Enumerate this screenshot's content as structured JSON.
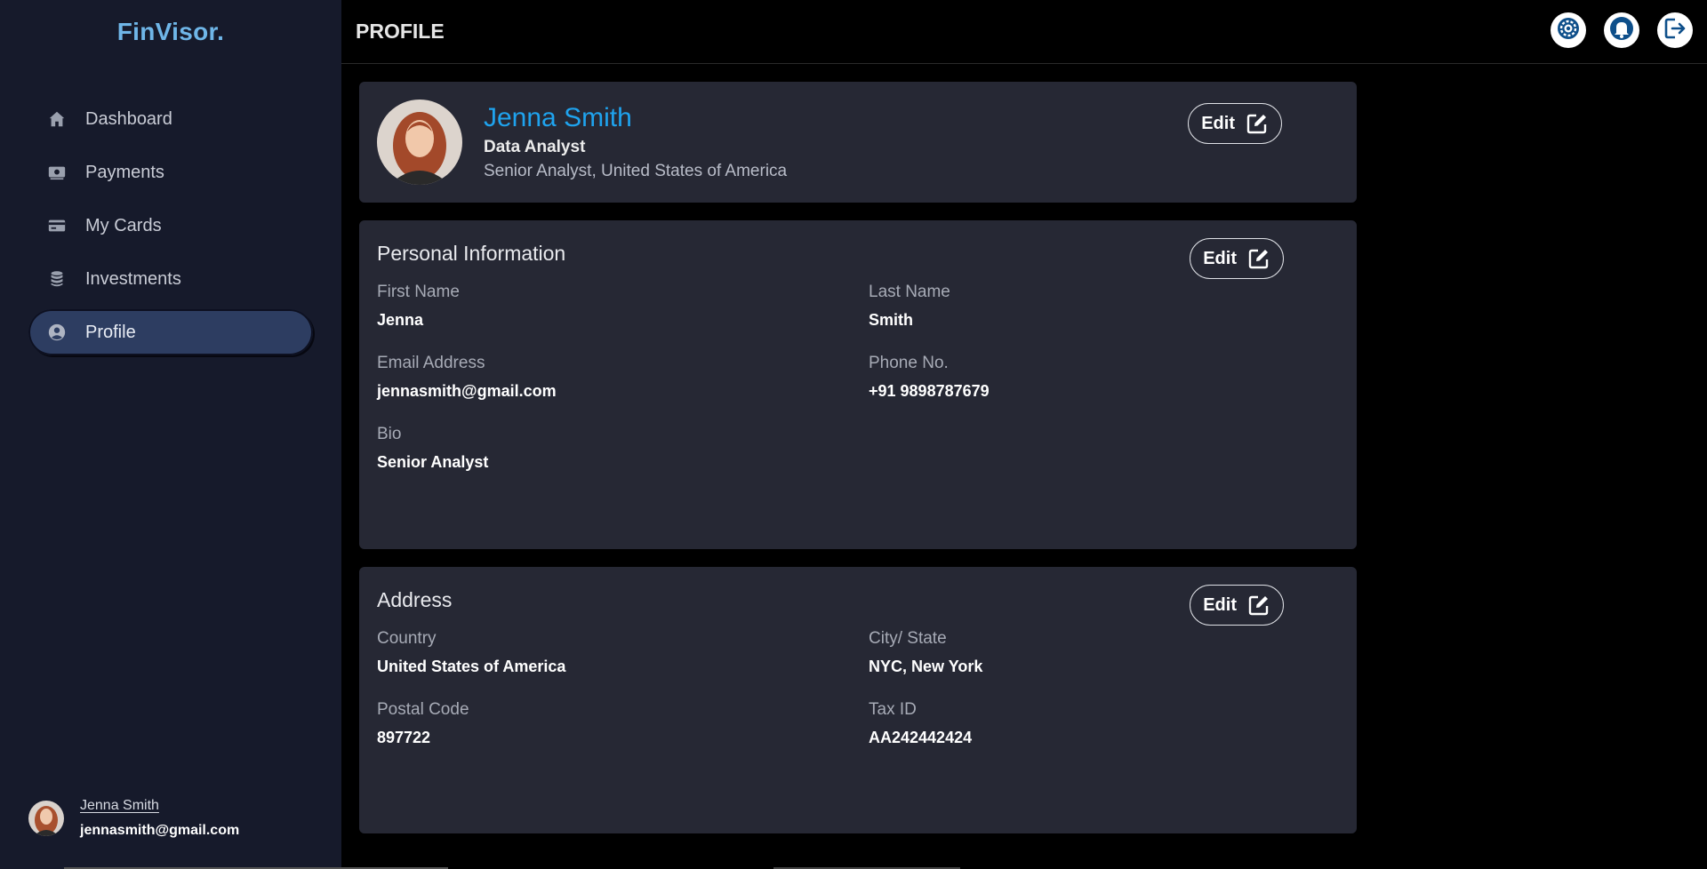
{
  "brand": "FinVisor.",
  "sidebar": {
    "items": [
      {
        "label": "Dashboard",
        "icon": "home-icon"
      },
      {
        "label": "Payments",
        "icon": "payments-icon"
      },
      {
        "label": "My Cards",
        "icon": "card-icon"
      },
      {
        "label": "Investments",
        "icon": "coins-icon"
      },
      {
        "label": "Profile",
        "icon": "user-circle-icon",
        "active": true
      }
    ],
    "user": {
      "name": "Jenna Smith",
      "email": "jennasmith@gmail.com"
    }
  },
  "header": {
    "title": "PROFILE",
    "actions": [
      "settings-icon",
      "bell-icon",
      "logout-icon"
    ]
  },
  "profile": {
    "name": "Jenna Smith",
    "role": "Data Analyst",
    "location": "Senior Analyst, United States of America",
    "edit_label": "Edit"
  },
  "personal": {
    "title": "Personal Information",
    "edit_label": "Edit",
    "first_name_label": "First Name",
    "first_name": "Jenna",
    "last_name_label": "Last Name",
    "last_name": "Smith",
    "email_label": "Email Address",
    "email": "jennasmith@gmail.com",
    "phone_label": "Phone No.",
    "phone": "+91 9898787679",
    "bio_label": "Bio",
    "bio": "Senior Analyst"
  },
  "address": {
    "title": "Address",
    "edit_label": "Edit",
    "country_label": "Country",
    "country": "United States of America",
    "city_label": "City/ State",
    "city": "NYC, New York",
    "postal_label": "Postal Code",
    "postal": "897722",
    "tax_label": "Tax ID",
    "tax": "AA242442424"
  },
  "colors": {
    "sidebar_bg": "#161a2b",
    "card_bg": "#262834",
    "accent": "#1fa3ee",
    "brand": "#6fb6e8",
    "active_nav": "#2d3d61"
  }
}
